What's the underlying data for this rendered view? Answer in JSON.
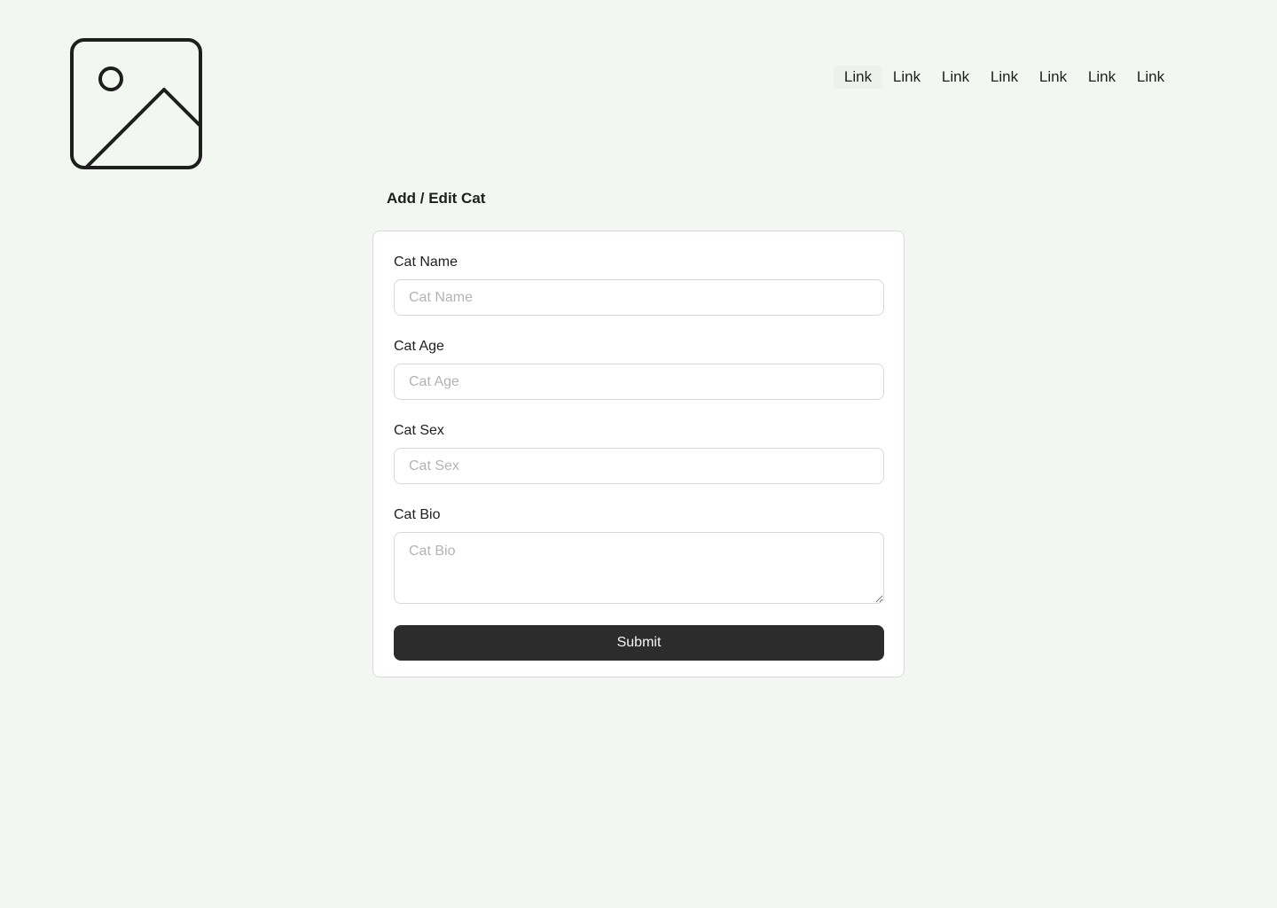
{
  "header": {
    "logo_icon": "image-placeholder-icon",
    "nav_links": [
      "Link",
      "Link",
      "Link",
      "Link",
      "Link",
      "Link",
      "Link"
    ]
  },
  "page": {
    "title": "Add / Edit Cat"
  },
  "form": {
    "fields": [
      {
        "label": "Cat Name",
        "placeholder": "Cat Name",
        "value": ""
      },
      {
        "label": "Cat Age",
        "placeholder": "Cat Age",
        "value": ""
      },
      {
        "label": "Cat Sex",
        "placeholder": "Cat Sex",
        "value": ""
      },
      {
        "label": "Cat Bio",
        "placeholder": "Cat Bio",
        "value": ""
      }
    ],
    "submit_label": "Submit"
  },
  "colors": {
    "background": "#f3f7f2",
    "card": "#ffffff",
    "button": "#2c2c2c",
    "text": "#1e1e1e",
    "placeholder": "#b3b3b3"
  }
}
